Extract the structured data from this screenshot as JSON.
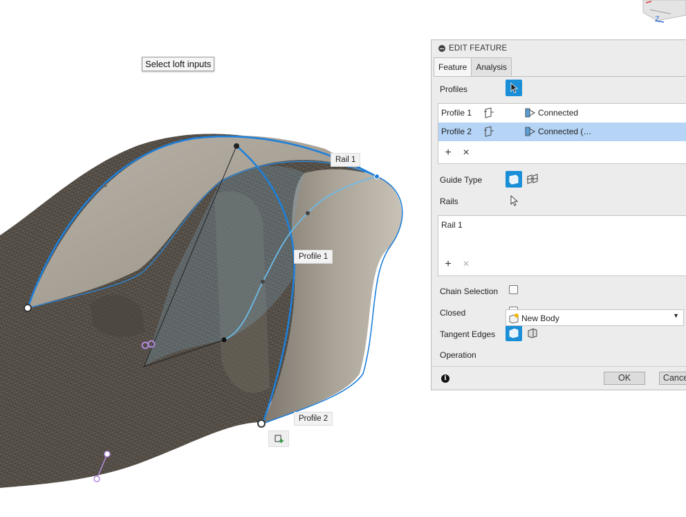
{
  "viewport": {
    "hint_text": "Select loft inputs",
    "labels": {
      "rail1": "Rail 1",
      "profile1": "Profile 1",
      "profile2": "Profile 2"
    },
    "viewcube_axis": "Z"
  },
  "panel": {
    "header": "EDIT FEATURE",
    "tabs": [
      {
        "label": "Feature",
        "active": true
      },
      {
        "label": "Analysis",
        "active": false
      }
    ],
    "profiles_label": "Profiles",
    "profiles": [
      {
        "name": "Profile 1",
        "continuity": "Connected",
        "selected": false
      },
      {
        "name": "Profile 2",
        "continuity": "Connected (…",
        "selected": true
      }
    ],
    "guide_type_label": "Guide Type",
    "rails_label": "Rails",
    "rails": [
      {
        "name": "Rail 1"
      }
    ],
    "chain_selection_label": "Chain Selection",
    "chain_selection_checked": false,
    "closed_label": "Closed",
    "closed_checked": false,
    "tangent_edges_label": "Tangent Edges",
    "operation_label": "Operation",
    "operation_value": "New Body",
    "ok_label": "OK",
    "cancel_label": "Cance",
    "add_symbol": "+",
    "remove_symbol": "×"
  },
  "colors": {
    "accent_blue": "#1a8fd8",
    "selection_row": "#b5d4f6",
    "rail_blue": "#1e7fd9",
    "sketch_purple": "#b48be0"
  }
}
